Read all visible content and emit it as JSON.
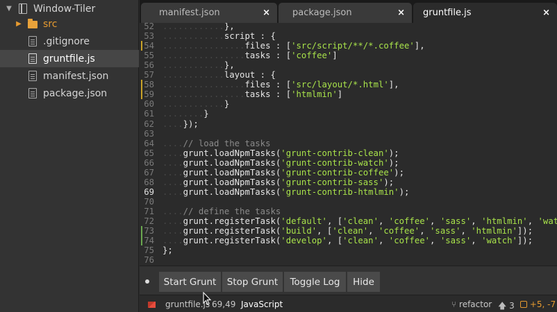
{
  "sidebar": {
    "root": "Window-Tiler",
    "items": [
      {
        "label": "src",
        "type": "folder"
      },
      {
        "label": ".gitignore",
        "type": "file"
      },
      {
        "label": "gruntfile.js",
        "type": "file",
        "selected": true
      },
      {
        "label": "manifest.json",
        "type": "file"
      },
      {
        "label": "package.json",
        "type": "file"
      }
    ]
  },
  "tabs": [
    {
      "label": "manifest.json",
      "close": "×"
    },
    {
      "label": "package.json",
      "close": "×"
    },
    {
      "label": "gruntfile.js",
      "close": "×",
      "active": true
    }
  ],
  "editor": {
    "current_line": 69,
    "lines": [
      {
        "n": "52",
        "indent": "............",
        "code": "},"
      },
      {
        "n": "53",
        "indent": "............",
        "code": "script : {"
      },
      {
        "n": "54",
        "indent": "................",
        "code": "files : ['src/script/**/*.coffee'],",
        "mark": "#c9a227"
      },
      {
        "n": "55",
        "indent": "................",
        "code": "tasks : ['coffee']"
      },
      {
        "n": "56",
        "indent": "............",
        "code": "},"
      },
      {
        "n": "57",
        "indent": "............",
        "code": "layout : {"
      },
      {
        "n": "58",
        "indent": "................",
        "code": "files : ['src/layout/*.html'],",
        "mark": "#c9a227"
      },
      {
        "n": "59",
        "indent": "................",
        "code": "tasks : ['htmlmin']",
        "mark": "#c9a227"
      },
      {
        "n": "60",
        "indent": "............",
        "code": "}"
      },
      {
        "n": "61",
        "indent": "........",
        "code": "}"
      },
      {
        "n": "62",
        "indent": "....",
        "code": "});"
      },
      {
        "n": "63",
        "indent": "",
        "code": ""
      },
      {
        "n": "64",
        "indent": "....",
        "code": "// load the tasks",
        "comment": true
      },
      {
        "n": "65",
        "indent": "....",
        "code": "grunt.loadNpmTasks('grunt-contrib-clean');"
      },
      {
        "n": "66",
        "indent": "....",
        "code": "grunt.loadNpmTasks('grunt-contrib-watch');"
      },
      {
        "n": "67",
        "indent": "....",
        "code": "grunt.loadNpmTasks('grunt-contrib-coffee');"
      },
      {
        "n": "68",
        "indent": "....",
        "code": "grunt.loadNpmTasks('grunt-contrib-sass');"
      },
      {
        "n": "69",
        "indent": "....",
        "code": "grunt.loadNpmTasks('grunt-contrib-htmlmin');"
      },
      {
        "n": "70",
        "indent": "",
        "code": ""
      },
      {
        "n": "71",
        "indent": "....",
        "code": "// define the tasks",
        "comment": true
      },
      {
        "n": "72",
        "indent": "....",
        "code": "grunt.registerTask('default', ['clean', 'coffee', 'sass', 'htmlmin', 'watch']);"
      },
      {
        "n": "73",
        "indent": "....",
        "code": "grunt.registerTask('build', ['clean', 'coffee', 'sass', 'htmlmin']);",
        "mark": "#6aa84f"
      },
      {
        "n": "74",
        "indent": "....",
        "code": "grunt.registerTask('develop', ['clean', 'coffee', 'sass', 'watch']);",
        "mark": "#6aa84f"
      },
      {
        "n": "75",
        "indent": "",
        "code": "};"
      },
      {
        "n": "76",
        "indent": "",
        "code": ""
      }
    ]
  },
  "grunt_panel": {
    "buttons": [
      "Start Grunt",
      "Stop Grunt",
      "Toggle Log",
      "Hide"
    ]
  },
  "status": {
    "file": "gruntfile.js",
    "position": "69,49",
    "grammar": "JavaScript",
    "branch": "refactor",
    "ahead": "3",
    "diff": "+5, -7"
  },
  "icons": {
    "project": "book-icon",
    "folder": "folder-icon",
    "file": "file-icon",
    "error": "lint-error-icon",
    "branch": "git-branch-icon",
    "ahead": "arrow-up-icon",
    "diff": "git-diff-icon"
  },
  "colors": {
    "string": "#a8e24a",
    "modified_gutter": "#c9a227",
    "added_gutter": "#6aa84f",
    "diff_badge": "#e69a30"
  }
}
